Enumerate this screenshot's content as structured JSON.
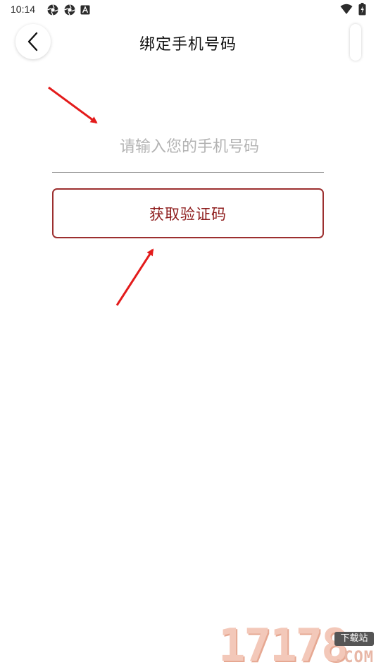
{
  "status_bar": {
    "time": "10:14",
    "left_icons": [
      "aperture-icon",
      "aperture-icon",
      "font-a-icon"
    ],
    "right_icons": [
      "wifi-icon",
      "battery-charging-icon"
    ]
  },
  "header": {
    "title": "绑定手机号码",
    "back_icon": "chevron-left-icon"
  },
  "form": {
    "phone_placeholder": "请输入您的手机号码",
    "phone_value": "",
    "get_code_label": "获取验证码"
  },
  "watermark": {
    "digits": "17178",
    "badge": "下载站",
    "domain": ".COM"
  },
  "colors": {
    "accent": "#8e1c1c",
    "button_border": "#9c2f2f",
    "annotation_arrow": "#e31b1b",
    "placeholder": "#b3b3b3"
  }
}
